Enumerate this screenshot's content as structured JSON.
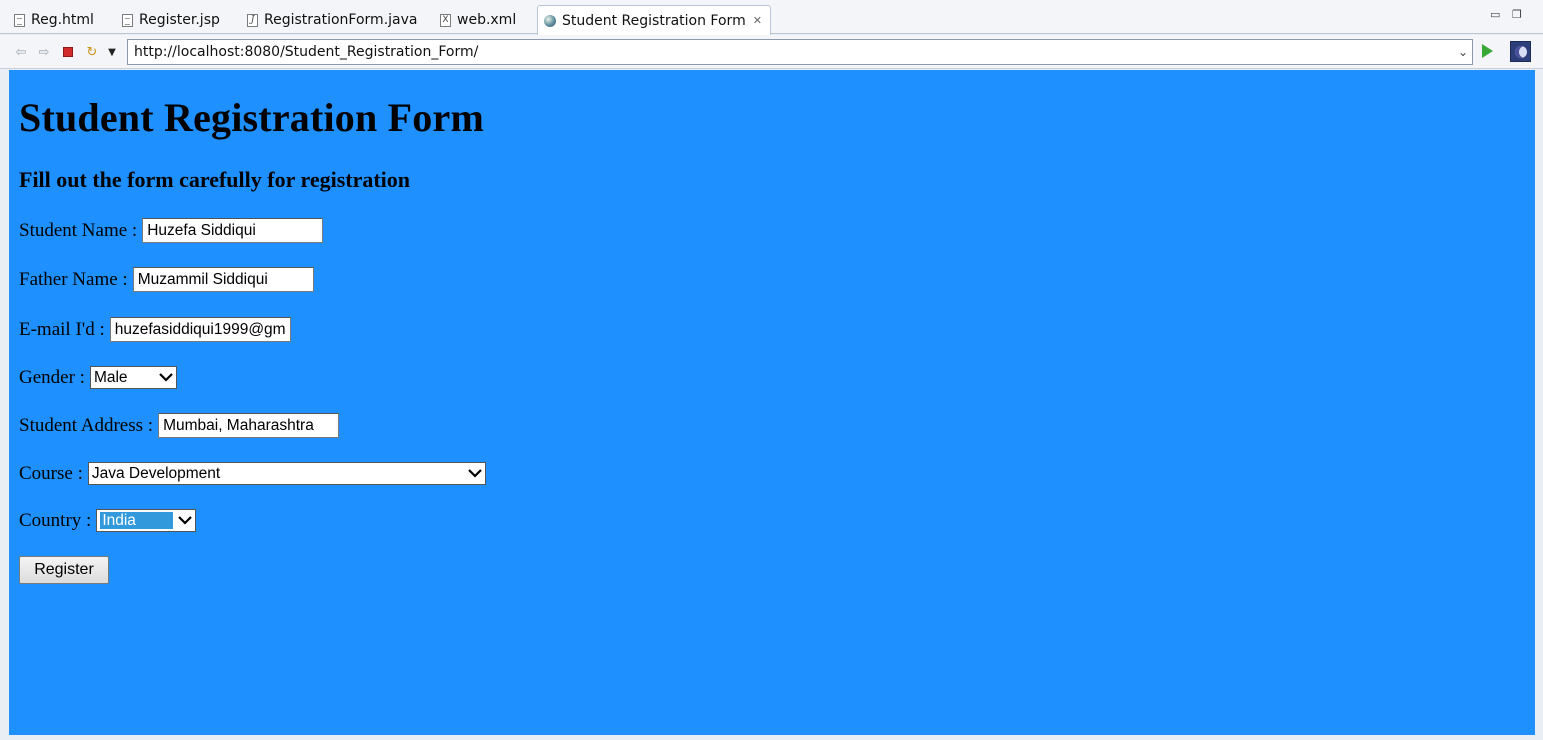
{
  "editor_tabs": [
    {
      "label": "Reg.html",
      "icon": "html-file-icon"
    },
    {
      "label": "Register.jsp",
      "icon": "jsp-file-icon"
    },
    {
      "label": "RegistrationForm.java",
      "icon": "java-file-icon"
    },
    {
      "label": "web.xml",
      "icon": "xml-file-icon"
    },
    {
      "label": "Student Registration Form",
      "icon": "globe-icon",
      "active": true
    }
  ],
  "toolbar": {
    "url": "http://localhost:8080/Student_Registration_Form/"
  },
  "page": {
    "title": "Student Registration Form",
    "subtitle": "Fill out the form carefully for registration",
    "background_color": "#1e90ff",
    "fields": {
      "student_name": {
        "label": "Student Name :",
        "value": "Huzefa Siddiqui"
      },
      "father_name": {
        "label": "Father Name :",
        "value": "Muzammil Siddiqui"
      },
      "email": {
        "label": "E-mail I'd :",
        "value": "huzefasiddiqui1999@gm"
      },
      "gender": {
        "label": "Gender :",
        "value": "Male"
      },
      "address": {
        "label": "Student Address :",
        "value": "Mumbai, Maharashtra"
      },
      "course": {
        "label": "Course :",
        "value": "Java Development"
      },
      "country": {
        "label": "Country :",
        "value": "India"
      }
    },
    "register_label": "Register"
  }
}
